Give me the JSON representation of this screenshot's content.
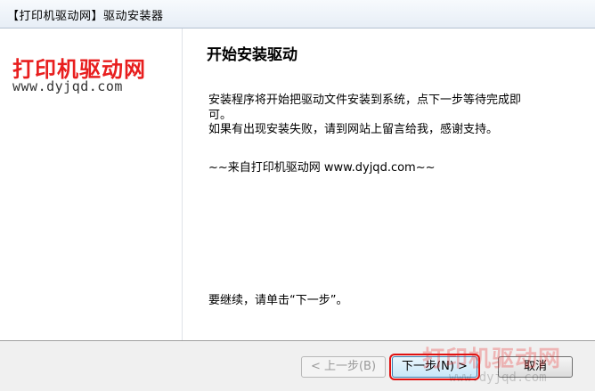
{
  "window": {
    "title": "【打印机驱动网】驱动安装器"
  },
  "logo": {
    "name": "打印机驱动网",
    "url": "www.dyjqd.com"
  },
  "content": {
    "heading": "开始安装驱动",
    "paragraph1": "安装程序将开始把驱动文件安装到系统，点下一步等待完成即可。",
    "paragraph2": "如果有出现安装失败，请到网站上留言给我，感谢支持。",
    "paragraph3": "~~来自打印机驱动网 www.dyjqd.com~~",
    "continue_text": "要继续，请单击“下一步”。"
  },
  "buttons": {
    "back_label": "< 上一步(B)",
    "next_label": "下一步(N) >",
    "cancel_label": "取消"
  },
  "watermark": {
    "name": "打印机驱动网",
    "url": "www.dyjqd.com"
  },
  "colors": {
    "logo_red": "#e81e1e",
    "highlight_red": "#e01010"
  }
}
